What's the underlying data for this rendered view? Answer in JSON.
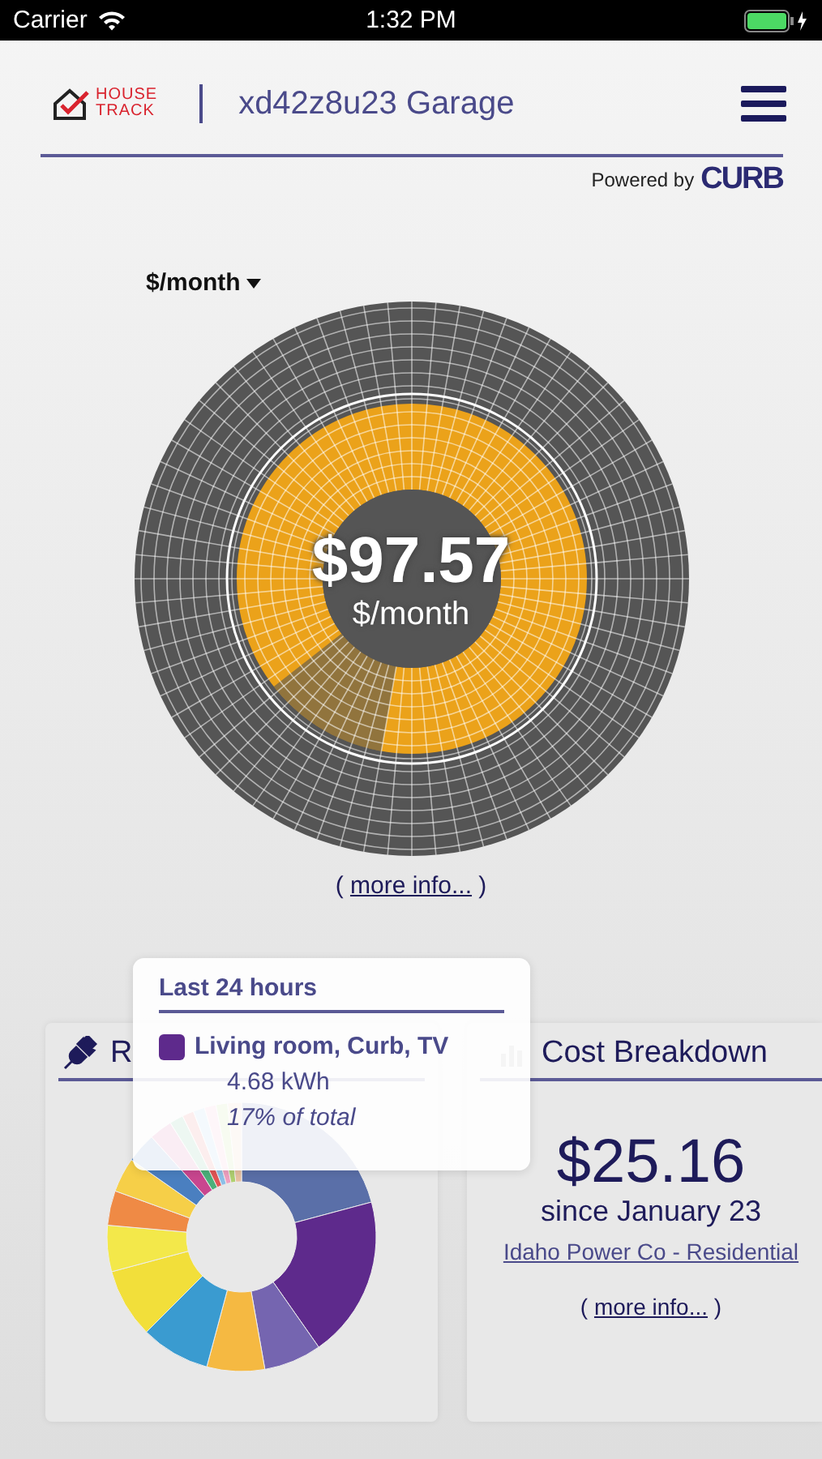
{
  "status_bar": {
    "carrier": "Carrier",
    "time": "1:32 PM"
  },
  "header": {
    "logo": [
      "HOUSE",
      "TRACK"
    ],
    "title": "xd42z8u23 Garage",
    "powered_by": "Powered by",
    "brand": "CURB"
  },
  "gauge": {
    "unit_selector": "$/month",
    "value": "$97.57",
    "unit": "$/month",
    "more_info": {
      "prefix": "( ",
      "link": "more info...",
      "suffix": " )"
    }
  },
  "cards": [
    {
      "kind": "usage",
      "title": "R"
    },
    {
      "kind": "cost",
      "title": "Cost Breakdown",
      "amount": "$25.16",
      "since": "since January 23",
      "plan": "Idaho Power Co - Residential",
      "more_info": {
        "prefix": "( ",
        "link": "more info...",
        "suffix": " )"
      }
    }
  ],
  "tooltip": {
    "title": "Last 24 hours",
    "item": "Living room, Curb, TV",
    "color": "#5e2a8c",
    "energy": "4.68 kWh",
    "share": "17% of total"
  }
}
